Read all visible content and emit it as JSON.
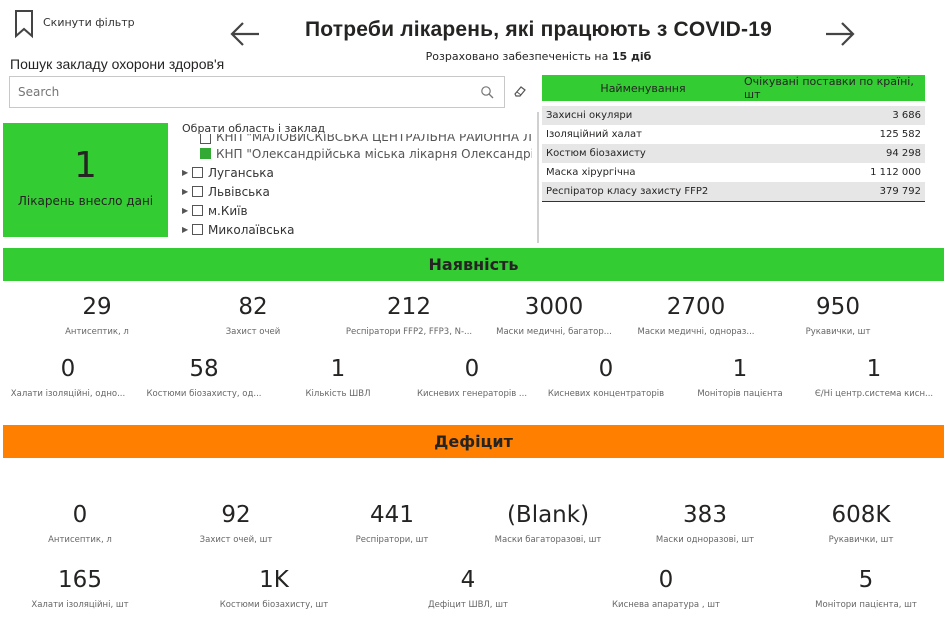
{
  "header": {
    "reset_label": "Скинути фільтр",
    "title": "Потреби лікарень, які працюють з COVID-19",
    "subtitle_prefix": "Розраховано забезпеченість на ",
    "subtitle_value": "15 діб"
  },
  "search": {
    "title": "Пошук закладу охорони здоров'я",
    "placeholder": "Search"
  },
  "kpi": {
    "value": "1",
    "label": "Лікарень внесло дані"
  },
  "tree": {
    "header": "Обрати область і заклад",
    "cut_item": "КНП \"МАЛОВИСКІВСЬКА ЦЕНТРАЛЬНА РАЙОННА ЛІКА",
    "selected_item": "КНП \"Олександрійська міська лікарня Олександрійськ",
    "regions": [
      "Луганська",
      "Львівська",
      "м.Київ",
      "Миколаївська"
    ]
  },
  "supply_table": {
    "col_name": "Найменування",
    "col_value": "Очікувані поставки по країні, шт",
    "rows": [
      {
        "name": "Захисні окуляри",
        "value": "3 686"
      },
      {
        "name": "Ізоляційний халат",
        "value": "125 582"
      },
      {
        "name": "Костюм біозахисту",
        "value": "94 298"
      },
      {
        "name": "Маска хірургічна",
        "value": "1 112 000"
      },
      {
        "name": "Респіратор класу захисту FFP2",
        "value": "379 792"
      }
    ]
  },
  "availability": {
    "title": "Наявність",
    "row1": [
      {
        "value": "29",
        "label": "Антисептик, л"
      },
      {
        "value": "82",
        "label": "Захист очей"
      },
      {
        "value": "212",
        "label": "Респіратори FFP2, FFP3, N-..."
      },
      {
        "value": "3000",
        "label": "Маски медичні, багатор..."
      },
      {
        "value": "2700",
        "label": "Маски медичні, однораз..."
      },
      {
        "value": "950",
        "label": "Рукавички, шт"
      }
    ],
    "row2": [
      {
        "value": "0",
        "label": "Халати ізоляційні, одно..."
      },
      {
        "value": "58",
        "label": "Костюми біозахисту, од..."
      },
      {
        "value": "1",
        "label": "Кількість ШВЛ"
      },
      {
        "value": "0",
        "label": "Кисневих генераторів ..."
      },
      {
        "value": "0",
        "label": "Кисневих концентраторів"
      },
      {
        "value": "1",
        "label": "Моніторів пацієнта"
      },
      {
        "value": "1",
        "label": "Є/Ні центр.система кисн..."
      }
    ]
  },
  "deficit": {
    "title": "Дефіцит",
    "row1": [
      {
        "value": "0",
        "label": "Антисептик, л"
      },
      {
        "value": "92",
        "label": "Захист очей, шт"
      },
      {
        "value": "441",
        "label": "Респіратори, шт"
      },
      {
        "value": "(Blank)",
        "label": "Маски багаторазові, шт"
      },
      {
        "value": "383",
        "label": "Маски одноразові, шт"
      },
      {
        "value": "608K",
        "label": "Рукавички, шт"
      }
    ],
    "row2": [
      {
        "value": "165",
        "label": "Халати ізоляційні, шт"
      },
      {
        "value": "1K",
        "label": "Костюми біозахисту, шт"
      },
      {
        "value": "4",
        "label": "Дефіцит ШВЛ, шт"
      },
      {
        "value": "0",
        "label": "Киснева апаратура , шт"
      },
      {
        "value": "5",
        "label": "Монітори пацієнта, шт"
      }
    ]
  },
  "colors": {
    "green": "#33cc33",
    "orange": "#ff8000"
  }
}
